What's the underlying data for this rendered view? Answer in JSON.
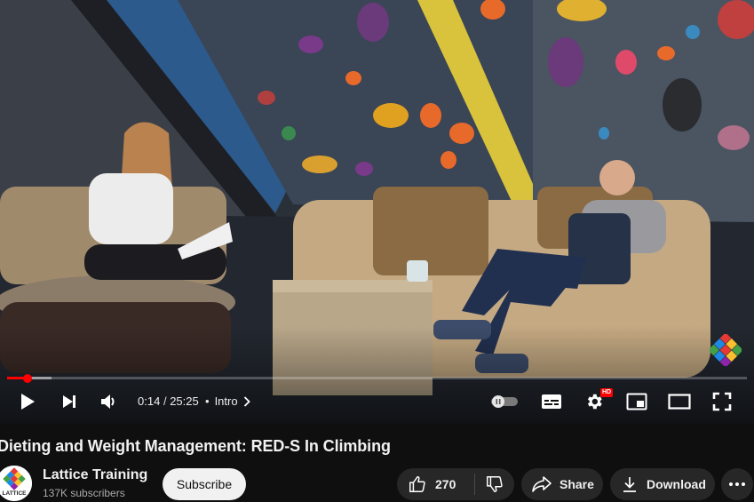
{
  "video": {
    "progress_played": 0.028,
    "progress_loaded": 0.06,
    "current_time": "0:14",
    "separator": "/",
    "duration": "25:25",
    "chapter_bullet": "•",
    "chapter": "Intro",
    "quality_badge": "HD",
    "autoplay_on": false
  },
  "title": "Dieting and Weight Management: RED-S In Climbing",
  "channel": {
    "name": "Lattice Training",
    "subscribers": "137K subscribers",
    "avatar_text": "LATTICE"
  },
  "actions": {
    "subscribe_label": "Subscribe",
    "like_count": "270",
    "share_label": "Share",
    "download_label": "Download"
  },
  "icons": {
    "play": "play-icon",
    "next": "next-icon",
    "volume": "volume-icon",
    "autoplay": "autoplay-toggle-icon",
    "captions": "captions-icon",
    "settings": "gear-icon",
    "miniplayer": "miniplayer-icon",
    "theater": "theater-icon",
    "fullscreen": "fullscreen-icon",
    "like": "thumbs-up-icon",
    "dislike": "thumbs-down-icon",
    "share": "share-icon",
    "download": "download-icon",
    "more": "more-dots-icon"
  },
  "colors": {
    "progress": "#ff0000",
    "page_bg": "#0f0f0f",
    "pill_bg": "#272727",
    "subscribe_bg": "#f1f1f1"
  }
}
